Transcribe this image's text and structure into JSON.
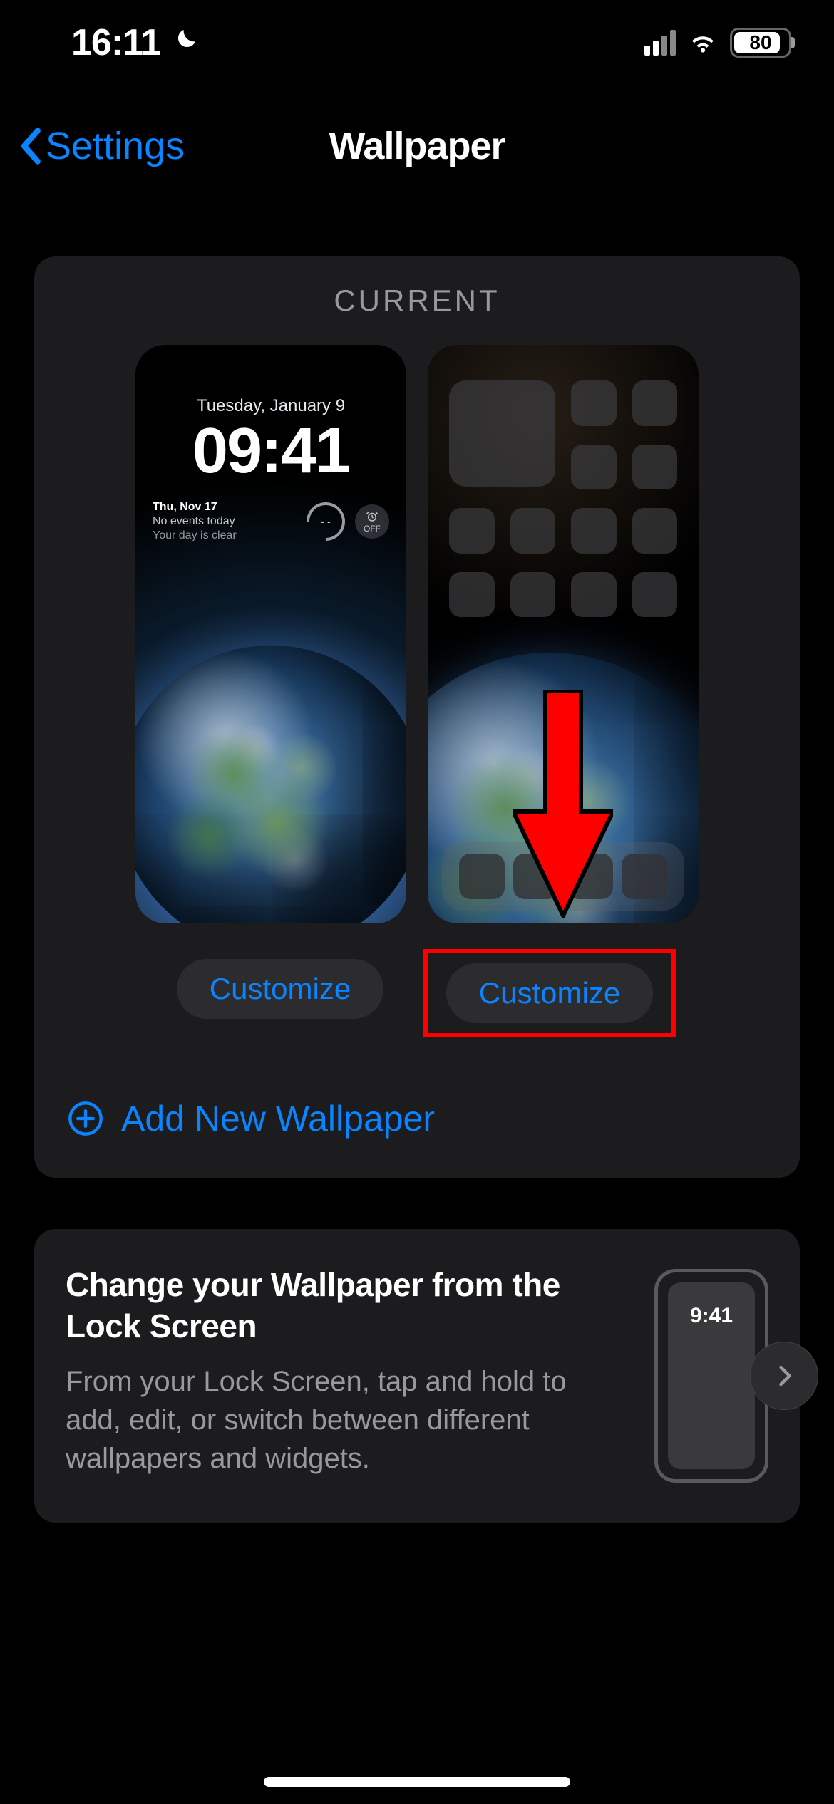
{
  "status": {
    "time": "16:11",
    "battery_percent": "80"
  },
  "nav": {
    "back_label": "Settings",
    "title": "Wallpaper"
  },
  "current": {
    "label": "CURRENT",
    "lock_screen": {
      "date_line": "Tuesday, January 9",
      "time": "09:41",
      "widget_line1": "Thu, Nov 17",
      "widget_line2": "No events today",
      "widget_line3": "Your day is clear",
      "gauge_value": "- -",
      "alarm_label": "OFF"
    },
    "customize_lock_label": "Customize",
    "customize_home_label": "Customize",
    "add_new_label": "Add New Wallpaper"
  },
  "tip": {
    "title": "Change your Wallpaper from the Lock Screen",
    "body": "From your Lock Screen, tap and hold to add, edit, or switch between different wallpapers and widgets.",
    "phone_time": "9:41"
  }
}
